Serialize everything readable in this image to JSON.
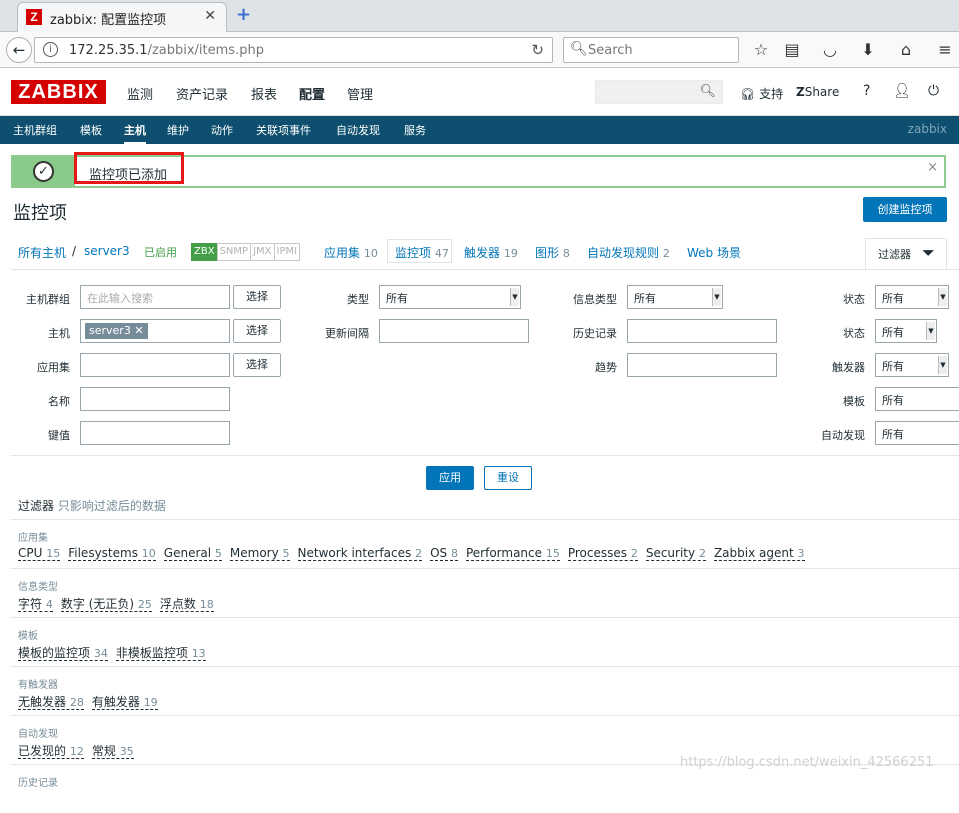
{
  "browser": {
    "tab_title": "zabbix: 配置监控项",
    "favicon_letter": "Z",
    "url_host": "172.25.35.1",
    "url_path": "/zabbix/items.php",
    "search_placeholder": "Search"
  },
  "header": {
    "logo": "ZABBIX",
    "menu": [
      "监测",
      "资产记录",
      "报表",
      "配置",
      "管理"
    ],
    "support": "支持",
    "share": "Share",
    "help": "?"
  },
  "submenu": {
    "items": [
      "主机群组",
      "模板",
      "主机",
      "维护",
      "动作",
      "关联项事件",
      "自动发现",
      "服务"
    ],
    "right": "zabbix"
  },
  "message": {
    "text": "监控项已添加",
    "close": "×"
  },
  "page": {
    "title": "监控项",
    "create_button": "创建监控项"
  },
  "host_nav": {
    "all_hosts": "所有主机",
    "sep": "/",
    "host": "server3",
    "enabled": "已启用",
    "zbx": [
      "ZBX",
      "SNMP",
      "JMX",
      "IPMI"
    ],
    "tabs": [
      {
        "label": "应用集",
        "count": "10"
      },
      {
        "label": "监控项",
        "count": "47"
      },
      {
        "label": "触发器",
        "count": "19"
      },
      {
        "label": "图形",
        "count": "8"
      },
      {
        "label": "自动发现规则",
        "count": "2"
      },
      {
        "label": "Web 场景",
        "count": ""
      }
    ],
    "filter_tab": "过滤器"
  },
  "filter": {
    "host_group_label": "主机群组",
    "host_group_placeholder": "在此输入搜索",
    "select": "选择",
    "host_label": "主机",
    "host_tag": "server3",
    "app_label": "应用集",
    "name_label": "名称",
    "key_label": "键值",
    "type_label": "类型",
    "type_value": "所有",
    "interval_label": "更新间隔",
    "info_type_label": "信息类型",
    "info_type_value": "所有",
    "history_label": "历史记录",
    "trends_label": "趋势",
    "state_label": "状态",
    "state_value": "所有",
    "status_label": "状态",
    "status_value": "所有",
    "triggers_label": "触发器",
    "triggers_value": "所有",
    "template_label": "模板",
    "template_value": "所有",
    "discovery_label": "自动发现",
    "discovery_value": "所有",
    "apply": "应用",
    "reset": "重设",
    "note_title": "过滤器",
    "note_text": "只影响过滤后的数据"
  },
  "subfilters": [
    {
      "title": "应用集",
      "items": [
        [
          "CPU",
          "15"
        ],
        [
          "Filesystems",
          "10"
        ],
        [
          "General",
          "5"
        ],
        [
          "Memory",
          "5"
        ],
        [
          "Network interfaces",
          "2"
        ],
        [
          "OS",
          "8"
        ],
        [
          "Performance",
          "15"
        ],
        [
          "Processes",
          "2"
        ],
        [
          "Security",
          "2"
        ],
        [
          "Zabbix agent",
          "3"
        ]
      ]
    },
    {
      "title": "信息类型",
      "items": [
        [
          "字符",
          "4"
        ],
        [
          "数字 (无正负)",
          "25"
        ],
        [
          "浮点数",
          "18"
        ]
      ]
    },
    {
      "title": "模板",
      "items": [
        [
          "模板的监控项",
          "34"
        ],
        [
          "非模板监控项",
          "13"
        ]
      ]
    },
    {
      "title": "有触发器",
      "items": [
        [
          "无触发器",
          "28"
        ],
        [
          "有触发器",
          "19"
        ]
      ]
    },
    {
      "title": "自动发现",
      "items": [
        [
          "已发现的",
          "12"
        ],
        [
          "常规",
          "35"
        ]
      ]
    },
    {
      "title": "历史记录",
      "items": []
    }
  ],
  "watermark": "https://blog.csdn.net/weixin_42566251"
}
